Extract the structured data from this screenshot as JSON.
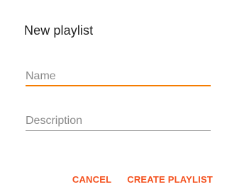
{
  "dialog": {
    "title": "New playlist",
    "name_field": {
      "placeholder": "Name",
      "value": ""
    },
    "description_field": {
      "placeholder": "Description",
      "value": ""
    },
    "cancel_label": "CANCEL",
    "create_label": "CREATE PLAYLIST"
  },
  "colors": {
    "accent": "#f57c00",
    "button_text": "#f4511e",
    "title_text": "#212121",
    "placeholder_text": "#8a8a8a",
    "inactive_underline": "#9e9e9e"
  }
}
